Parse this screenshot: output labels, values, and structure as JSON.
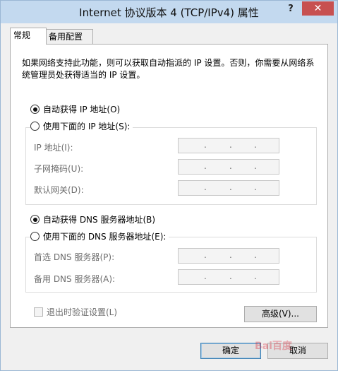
{
  "window": {
    "title": "Internet 协议版本 4 (TCP/IPv4) 属性",
    "help_label": "?",
    "close_label": "✕"
  },
  "tabs": [
    {
      "label": "常规",
      "active": true
    },
    {
      "label": "备用配置",
      "active": false
    }
  ],
  "description": "如果网络支持此功能，则可以获取自动指派的 IP 设置。否则，你需要从网络系统管理员处获得适当的 IP 设置。",
  "ip_section": {
    "auto_label": "自动获得 IP 地址(O)",
    "manual_label": "使用下面的 IP 地址(S):",
    "auto_selected": true,
    "fields": [
      {
        "label": "IP 地址(I):",
        "value": ". . ."
      },
      {
        "label": "子网掩码(U):",
        "value": ". . ."
      },
      {
        "label": "默认网关(D):",
        "value": ". . ."
      }
    ]
  },
  "dns_section": {
    "auto_label": "自动获得 DNS 服务器地址(B)",
    "manual_label": "使用下面的 DNS 服务器地址(E):",
    "auto_selected": true,
    "fields": [
      {
        "label": "首选 DNS 服务器(P):",
        "value": ". . ."
      },
      {
        "label": "备用 DNS 服务器(A):",
        "value": ". . ."
      }
    ]
  },
  "validate_checkbox": {
    "label": "退出时验证设置(L)",
    "checked": false,
    "enabled": false
  },
  "buttons": {
    "advanced": "高级(V)...",
    "ok": "确定",
    "cancel": "取消"
  },
  "watermark": "Bai百度"
}
